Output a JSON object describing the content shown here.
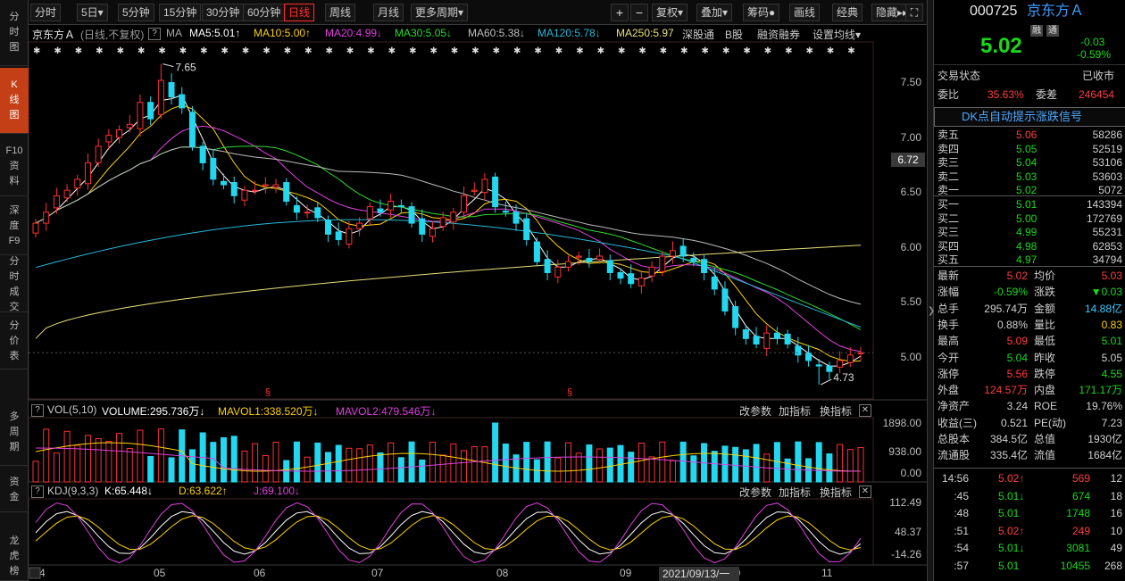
{
  "side_tabs": [
    {
      "label": "分时图"
    },
    {
      "label": "K线图"
    },
    {
      "label": "F10资料"
    },
    {
      "label": "深度F9"
    },
    {
      "label": "分时成交"
    },
    {
      "label": "分价表"
    },
    {
      "label": "多周期"
    },
    {
      "label": "资金"
    },
    {
      "label": "龙虎榜"
    }
  ],
  "toolbar": {
    "periods": [
      "分时",
      "5日▾",
      "5分钟",
      "15分钟",
      "30分钟",
      "60分钟",
      "日线",
      "周线",
      "月线",
      "更多周期▾"
    ],
    "selected": "日线",
    "right_buttons": [
      "复权▾",
      "叠加▾",
      "筹码●",
      "画线",
      "经典",
      "隐藏▸▸"
    ]
  },
  "ma_legend": {
    "name": "京东方Ａ",
    "mode": "(日线,不复权)",
    "ma": "MA",
    "ma5": "MA5:5.01↑",
    "ma10": "MA10:5.00↑",
    "ma20": "MA20:4.99↓",
    "ma30": "MA30:5.05↓",
    "ma60": "MA60:5.38↓",
    "ma120": "MA120:5.78↓",
    "ma250": "MA250:5.97",
    "sh": "深股通",
    "b": "B股",
    "rz": "融资融券",
    "set": "设置均线▾"
  },
  "vol_legend": {
    "name": "VOL(5,10)",
    "v": "VOLUME:295.736万↓",
    "m1": "MAVOL1:338.520万↓",
    "m2": "MAVOL2:479.546万↓",
    "t1": "改参数",
    "t2": "加指标",
    "t3": "换指标"
  },
  "kdj_legend": {
    "name": "KDJ(9,3,3)",
    "k": "K:65.448↓",
    "d": "D:63.622↑",
    "j": "J:69.100↓",
    "t1": "改参数",
    "t2": "加指标",
    "t3": "换指标"
  },
  "annotations": {
    "high": "7.65",
    "low": "4.73",
    "price_tag": "6.72",
    "date_tag": "2021/09/13/一"
  },
  "chart_data": [
    {
      "type": "candlestick",
      "title": "京东方Ａ 日线",
      "y_ticks": [
        "7.50",
        "7.00",
        "6.50",
        "6.00",
        "5.50",
        "5.00"
      ],
      "ylim": [
        4.6,
        7.85
      ],
      "x_ticks": [
        "4",
        "05",
        "06",
        "07",
        "08",
        "09",
        "10",
        "11"
      ],
      "ma_values": {
        "MA5": 5.01,
        "MA10": 5.0,
        "MA20": 4.99,
        "MA30": 5.05,
        "MA60": 5.38,
        "MA120": 5.78,
        "MA250": 5.97
      },
      "high": 7.65,
      "low": 4.73,
      "last": 5.02,
      "approx_close": [
        6.2,
        6.3,
        6.45,
        6.5,
        6.6,
        6.75,
        6.9,
        7.0,
        7.05,
        7.1,
        7.3,
        7.15,
        7.5,
        7.35,
        7.25,
        6.9,
        6.75,
        6.6,
        6.55,
        6.45,
        6.5,
        6.5,
        6.55,
        6.55,
        6.4,
        6.3,
        6.3,
        6.25,
        6.1,
        6.05,
        6.15,
        6.2,
        6.35,
        6.3,
        6.4,
        6.35,
        6.2,
        6.1,
        6.15,
        6.25,
        6.3,
        6.45,
        6.5,
        6.6,
        6.35,
        6.3,
        6.2,
        6.05,
        5.85,
        5.75,
        5.8,
        5.85,
        5.9,
        5.85,
        5.9,
        5.75,
        5.7,
        5.65,
        5.7,
        5.8,
        5.9,
        5.95,
        5.9,
        5.85,
        5.75,
        5.6,
        5.4,
        5.25,
        5.15,
        5.1,
        5.2,
        5.15,
        5.1,
        5.0,
        4.95,
        4.9,
        4.85,
        4.95,
        5.0,
        5.02
      ]
    },
    {
      "type": "bar",
      "title": "VOL(5,10)",
      "y_ticks": [
        "1898.00",
        "938.00",
        "0.00"
      ],
      "series": [
        {
          "name": "VOLUME",
          "last": 295.736
        },
        {
          "name": "MAVOL1",
          "last": 338.52
        },
        {
          "name": "MAVOL2",
          "last": 479.546
        }
      ]
    },
    {
      "type": "line",
      "title": "KDJ(9,3,3)",
      "y_ticks": [
        "112.49",
        "48.37",
        "-14.26"
      ],
      "series": [
        {
          "name": "K",
          "last": 65.448
        },
        {
          "name": "D",
          "last": 63.622
        },
        {
          "name": "J",
          "last": 69.1
        }
      ]
    }
  ],
  "quote": {
    "code": "000725",
    "name": "京东方Ａ",
    "badge1": "融",
    "badge2": "通",
    "price": "5.02",
    "change": "-0.03",
    "pct": "-0.59%",
    "status_label": "交易状态",
    "status": "已收市",
    "wb_label": "委比",
    "wb": "35.63%",
    "wc_label": "委差",
    "wc": "246454",
    "dk": "DK点自动提示涨跌信号",
    "asks": [
      {
        "l": "卖五",
        "p": "5.06",
        "v": "58286"
      },
      {
        "l": "卖四",
        "p": "5.05",
        "v": "52519"
      },
      {
        "l": "卖三",
        "p": "5.04",
        "v": "53106"
      },
      {
        "l": "卖二",
        "p": "5.03",
        "v": "53603"
      },
      {
        "l": "卖一",
        "p": "5.02",
        "v": "5072"
      }
    ],
    "bids": [
      {
        "l": "买一",
        "p": "5.01",
        "v": "143394"
      },
      {
        "l": "买二",
        "p": "5.00",
        "v": "172769"
      },
      {
        "l": "买三",
        "p": "4.99",
        "v": "55231"
      },
      {
        "l": "买四",
        "p": "4.98",
        "v": "62853"
      },
      {
        "l": "买五",
        "p": "4.97",
        "v": "34794"
      }
    ],
    "stats": [
      {
        "a": "最新",
        "av": "5.02",
        "ac": "r",
        "b": "均价",
        "bv": "5.03",
        "bc": "r"
      },
      {
        "a": "涨幅",
        "av": "-0.59%",
        "ac": "g",
        "b": "涨跌",
        "bv": "▼0.03",
        "bc": "g"
      },
      {
        "a": "总手",
        "av": "295.74万",
        "ac": "w",
        "b": "金额",
        "bv": "14.88亿",
        "bc": "c"
      },
      {
        "a": "换手",
        "av": "0.88%",
        "ac": "w",
        "b": "量比",
        "bv": "0.83",
        "bc": "y"
      },
      {
        "a": "最高",
        "av": "5.09",
        "ac": "r",
        "b": "最低",
        "bv": "5.01",
        "bc": "g"
      },
      {
        "a": "今开",
        "av": "5.04",
        "ac": "g",
        "b": "昨收",
        "bv": "5.05",
        "bc": "w"
      },
      {
        "a": "涨停",
        "av": "5.56",
        "ac": "r",
        "b": "跌停",
        "bv": "4.55",
        "bc": "g"
      },
      {
        "a": "外盘",
        "av": "124.57万",
        "ac": "r",
        "b": "内盘",
        "bv": "171.17万",
        "bc": "g"
      },
      {
        "a": "净资产",
        "av": "3.24",
        "ac": "w",
        "b": "ROE",
        "bv": "19.76%",
        "bc": "w"
      },
      {
        "a": "收益(三)",
        "av": "0.521",
        "ac": "w",
        "b": "PE(动)",
        "bv": "7.23",
        "bc": "w"
      },
      {
        "a": "总股本",
        "av": "384.5亿",
        "ac": "w",
        "b": "总值",
        "bv": "1930亿",
        "bc": "w"
      },
      {
        "a": "流通股",
        "av": "335.4亿",
        "ac": "w",
        "b": "流值",
        "bv": "1684亿",
        "bc": "w"
      }
    ],
    "ticks": [
      {
        "t": "14:56",
        "p": "5.02↑",
        "pc": "r",
        "v": "569",
        "vc": "r",
        "n": "12"
      },
      {
        "t": ":45",
        "p": "5.01↓",
        "pc": "g",
        "v": "674",
        "vc": "g",
        "n": "18"
      },
      {
        "t": ":48",
        "p": "5.01",
        "pc": "g",
        "v": "1748",
        "vc": "g",
        "n": "16"
      },
      {
        "t": ":51",
        "p": "5.02↑",
        "pc": "r",
        "v": "249",
        "vc": "r",
        "n": "10"
      },
      {
        "t": ":54",
        "p": "5.01↓",
        "pc": "g",
        "v": "3081",
        "vc": "g",
        "n": "49"
      },
      {
        "t": ":57",
        "p": "5.01",
        "pc": "g",
        "v": "10455",
        "vc": "g",
        "n": "268"
      }
    ]
  }
}
